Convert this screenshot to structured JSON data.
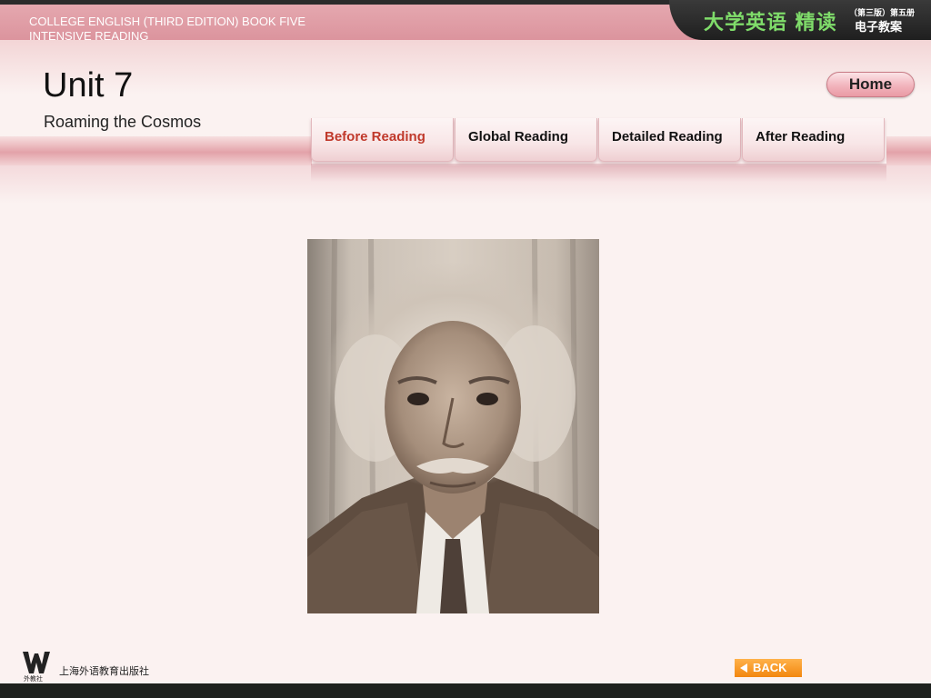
{
  "header": {
    "book_title_line1": "COLLEGE ENGLISH (THIRD EDITION) BOOK FIVE",
    "book_title_line2": "INTENSIVE READING",
    "logo_main": "大学英语 精读",
    "logo_edition": "（第三版）第五册",
    "logo_sub": "电子教案",
    "home_label": "Home"
  },
  "unit": {
    "title": "Unit 7",
    "subtitle": "Roaming the Cosmos"
  },
  "tabs": [
    {
      "label": "Before Reading",
      "active": true
    },
    {
      "label": "Global Reading",
      "active": false
    },
    {
      "label": "Detailed Reading",
      "active": false
    },
    {
      "label": "After Reading",
      "active": false
    }
  ],
  "footer": {
    "publisher_name": "上海外语教育出版社",
    "publisher_logo_text": "外教社",
    "back_label": "BACK"
  },
  "colors": {
    "accent_active_tab": "#c0392b",
    "back_button": "#f2860f",
    "logo_green": "#7fdc6a"
  },
  "icons": {
    "back": "left-triangle-arrow",
    "publisher": "w-logo"
  }
}
